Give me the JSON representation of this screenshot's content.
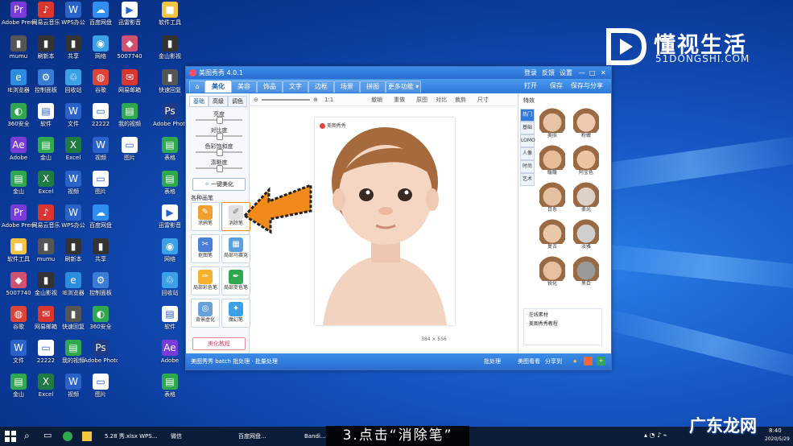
{
  "desktop": {
    "icons": [
      {
        "label": "Adobe Premiere...",
        "color": "#7b3bd8",
        "glyph": "Pr"
      },
      {
        "label": "网易云音乐",
        "color": "#d8362f",
        "glyph": "♪"
      },
      {
        "label": "WPS办公",
        "color": "#2a62c9",
        "glyph": "W"
      },
      {
        "label": "百度网盘",
        "color": "#2f8ef0",
        "glyph": "☁"
      },
      {
        "label": "迅雷影音",
        "color": "#ffffff",
        "glyph": "▶"
      },
      {
        "label": "软件工具",
        "color": "#f4c542",
        "glyph": "■"
      },
      {
        "label": "mumu",
        "color": "#555555",
        "glyph": "▮"
      },
      {
        "label": "刷新本",
        "color": "#333333",
        "glyph": "▮"
      },
      {
        "label": "共享",
        "color": "#333333",
        "glyph": "▮"
      },
      {
        "label": "网络",
        "color": "#3aa0e8",
        "glyph": "◉"
      },
      {
        "label": "5007740",
        "color": "#d05070",
        "glyph": "◆"
      },
      {
        "label": "金山影视",
        "color": "#333333",
        "glyph": "▮"
      },
      {
        "label": "IE浏览器",
        "color": "#2b8de0",
        "glyph": "e"
      },
      {
        "label": "控制面板",
        "color": "#3a7bd5",
        "glyph": "⚙"
      },
      {
        "label": "回收站",
        "color": "#3aa0e8",
        "glyph": "♲"
      },
      {
        "label": "谷歌",
        "color": "#db4437",
        "glyph": "◍"
      },
      {
        "label": "网易邮箱",
        "color": "#d8362f",
        "glyph": "✉"
      },
      {
        "label": "快速回复",
        "color": "#555555",
        "glyph": "▮"
      },
      {
        "label": "360安全",
        "color": "#2fa84f",
        "glyph": "◐"
      },
      {
        "label": "软件",
        "color": "#ffffff",
        "glyph": "▤"
      },
      {
        "label": "文件",
        "color": "#2a62c9",
        "glyph": "W"
      },
      {
        "label": "22222",
        "color": "#ffffff",
        "glyph": "▭"
      },
      {
        "label": "我的视频",
        "color": "#2fa84f",
        "glyph": "▤"
      },
      {
        "label": "Adobe Photoshop",
        "color": "#1e3a8a",
        "glyph": "Ps"
      },
      {
        "label": "Adobe",
        "color": "#7b3bd8",
        "glyph": "Ae"
      },
      {
        "label": "金山",
        "color": "#2fa84f",
        "glyph": "▤"
      },
      {
        "label": "Excel",
        "color": "#1f7a45",
        "glyph": "X"
      },
      {
        "label": "视频",
        "color": "#2a62c9",
        "glyph": "W"
      },
      {
        "label": "图片",
        "color": "#ffffff",
        "glyph": "▭"
      },
      {
        "label": "表格",
        "color": "#2fa84f",
        "glyph": "▤"
      }
    ]
  },
  "brand": {
    "name": "懂视生活",
    "url": "51DONGSHI.COM"
  },
  "app": {
    "title": "美图秀秀 4.0.1",
    "window_controls": {
      "min": "—",
      "max": "□",
      "close": "✕"
    },
    "top_links": [
      "登录",
      "反馈",
      "设置"
    ],
    "menu_tabs": [
      "美化",
      "美容",
      "饰品",
      "文字",
      "边框",
      "场景",
      "拼图",
      "更多功能 ▾"
    ],
    "menu_right": [
      "打开",
      "保存",
      "保存与分享"
    ],
    "home_icon": "home-icon",
    "left": {
      "subtabs": [
        "基础",
        "高级",
        "调色"
      ],
      "sliders": [
        {
          "label": "亮度",
          "value": 0.5
        },
        {
          "label": "对比度",
          "value": 0.5
        },
        {
          "label": "色彩饱和度",
          "value": 0.5
        },
        {
          "label": "清晰度",
          "value": 0.5
        }
      ],
      "one_click_button": "一键美化",
      "section_title": "各种画笔",
      "brushes": [
        {
          "label": "涂鸦笔",
          "color": "#f0a030",
          "glyph": "✎"
        },
        {
          "label": "消除笔",
          "color": "#e0e0e0",
          "glyph": "✐"
        },
        {
          "label": "抠图笔",
          "color": "#4a7fd8",
          "glyph": "✂"
        },
        {
          "label": "局部马赛克",
          "color": "#5aa0e0",
          "glyph": "▦"
        },
        {
          "label": "局部彩色笔",
          "color": "#f5b030",
          "glyph": "✑"
        },
        {
          "label": "局部变色笔",
          "color": "#2fa84f",
          "glyph": "✒"
        },
        {
          "label": "背景虚化",
          "color": "#6aa0d8",
          "glyph": "◎"
        },
        {
          "label": "魔幻笔",
          "color": "#3aa0e8",
          "glyph": "✦"
        }
      ],
      "footer_button": "美化教程"
    },
    "toolbar": {
      "zoom": "1:1",
      "actions": [
        "撤销",
        "重做",
        "原图",
        "对比",
        "裁剪",
        "尺寸"
      ]
    },
    "canvas": {
      "photo_tag": "美图秀秀"
    },
    "right": {
      "title": "特效",
      "vtabs": [
        "热门",
        "基础",
        "LOMO",
        "人像",
        "时尚",
        "艺术"
      ],
      "thumbs": [
        {
          "label": "美肤",
          "tone": "#e8c4a6"
        },
        {
          "label": "粉嫩",
          "tone": "#f0c8b0"
        },
        {
          "label": "暖暖",
          "tone": "#e7bc98"
        },
        {
          "label": "阿宝色",
          "tone": "#ecc4a2"
        },
        {
          "label": "日系",
          "tone": "#e4c0a0"
        },
        {
          "label": "柔光",
          "tone": "#ddd0c6"
        },
        {
          "label": "复古",
          "tone": "#e8c8a8"
        },
        {
          "label": "淡雅",
          "tone": "#cfcfcf"
        },
        {
          "label": "锐化",
          "tone": "#e8c0a0"
        },
        {
          "label": "黑白",
          "tone": "#9a9a9a"
        }
      ],
      "list": [
        "在线素材",
        "美图秀秀教程"
      ]
    },
    "status": {
      "left": "美图秀秀 batch 批处理 · 批量处理",
      "size": "384 × 556",
      "right": [
        "批处理",
        "美图看看",
        "分享到"
      ]
    }
  },
  "taskbar": {
    "items": [
      "5.28 秀.xlsx  WPS...",
      "微信",
      "百度网盘...",
      "Bandi..."
    ],
    "time": "8:40",
    "date": "2020/5/29"
  },
  "caption": "3.点击“消除笔”",
  "watermark": "广东龙网"
}
